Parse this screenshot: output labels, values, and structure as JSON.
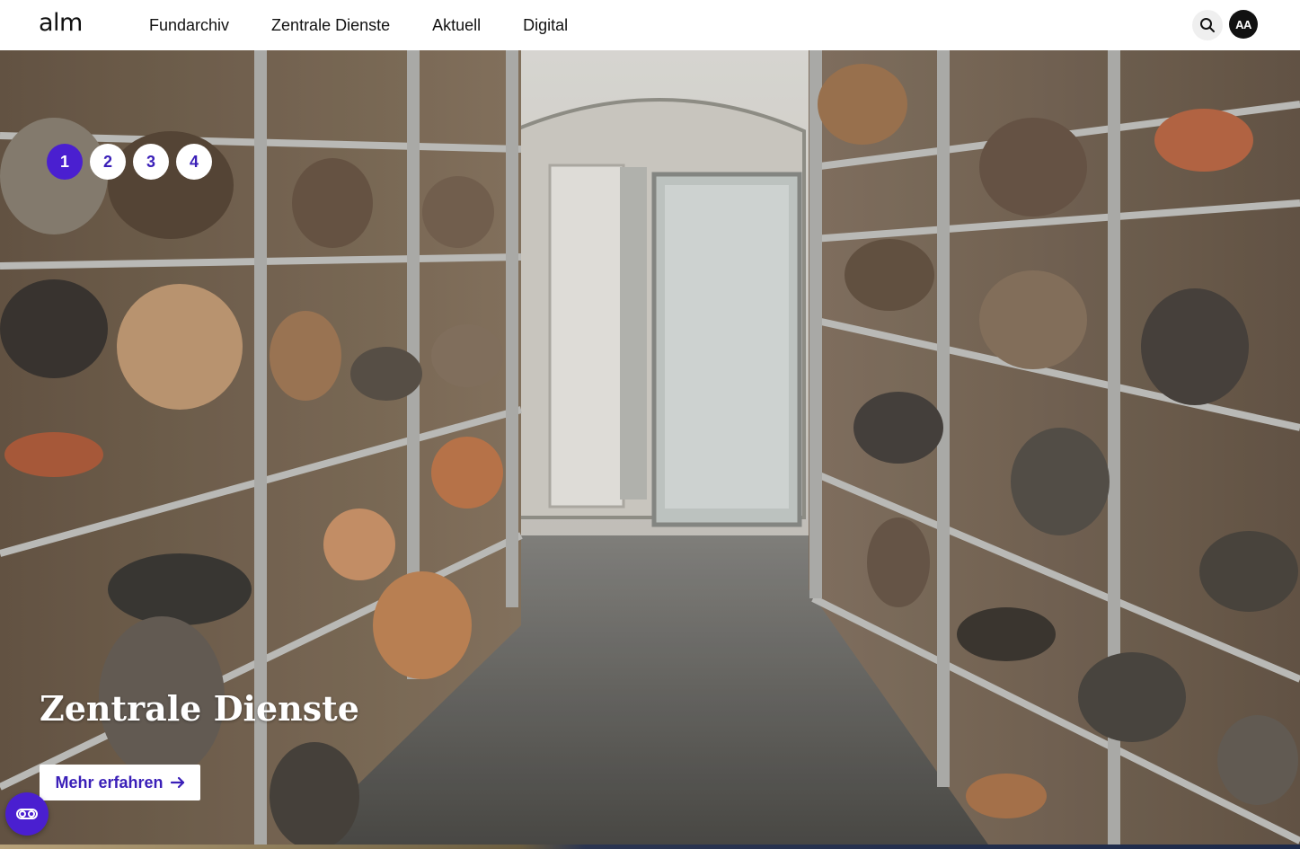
{
  "header": {
    "logo": "alm",
    "nav": [
      {
        "label": "Fundarchiv"
      },
      {
        "label": "Zentrale Dienste"
      },
      {
        "label": "Aktuell"
      },
      {
        "label": "Digital"
      }
    ],
    "search_icon": "search-icon",
    "text_size_label": "AA"
  },
  "hero": {
    "pager": [
      "1",
      "2",
      "3",
      "4"
    ],
    "active_slide": "1",
    "title": "Zentrale Dienste",
    "cta_label": "Mehr erfahren",
    "cta_icon": "arrow-right-icon"
  },
  "accessibility": {
    "icon": "accessibility-toggle-icon"
  },
  "colors": {
    "accent": "#4a1fd0",
    "header_bg": "#ffffff",
    "text": "#111111"
  }
}
